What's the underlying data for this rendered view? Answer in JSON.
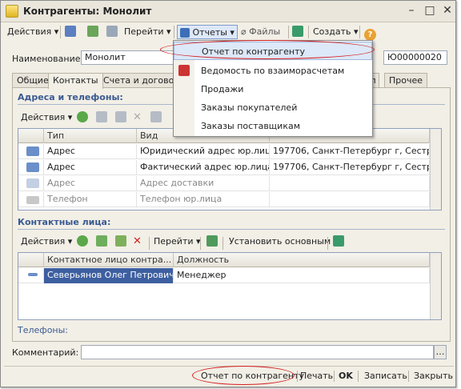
{
  "window": {
    "title": "Контрагенты: Монолит"
  },
  "toolbar": {
    "actions": "Действия",
    "goto": "Перейти",
    "reports": "Отчеты",
    "files": "Файлы",
    "create": "Создать"
  },
  "form": {
    "name_label": "Наименование:",
    "name_value": "Монолит",
    "code_value": "Ю00000020"
  },
  "tabs": [
    "Общие",
    "Контакты",
    "Счета и договоры",
    "Прочее"
  ],
  "tab_partial": "уп",
  "reports_menu": [
    "Отчет по контрагенту",
    "Ведомость по взаиморасчетам",
    "Продажи",
    "Заказы покупателей",
    "Заказы поставщикам"
  ],
  "addresses": {
    "section_title": "Адреса и телефоны:",
    "actions": "Действия",
    "columns": [
      "Тип",
      "Вид"
    ],
    "rows": [
      {
        "type": "Адрес",
        "kind": "Юридический адрес юр.лица",
        "value": "197706, Санкт-Петербург г, Сестро..."
      },
      {
        "type": "Адрес",
        "kind": "Фактический адрес юр.лица",
        "value": "197706, Санкт-Петербург г, Сестро..."
      },
      {
        "type": "Адрес",
        "kind": "Адрес доставки",
        "value": ""
      },
      {
        "type": "Телефон",
        "kind": "Телефон юр.лица",
        "value": ""
      }
    ]
  },
  "contacts": {
    "section_title": "Контактные лица:",
    "actions": "Действия",
    "goto": "Перейти",
    "set_main": "Установить основным",
    "columns": [
      "Контактное лицо контра...",
      "Должность"
    ],
    "rows": [
      {
        "name": "Северьянов Олег Петрович",
        "position": "Менеджер"
      }
    ]
  },
  "phones_label": "Телефоны:",
  "comment_label": "Комментарий:",
  "bottom": {
    "report": "Отчет по контрагенту",
    "print": "Печать",
    "ok": "OK",
    "save": "Записать",
    "close": "Закрыть"
  },
  "colors": {
    "highlight": "#dde8f8",
    "selection": "#3d5fa0",
    "annotation": "#d21d1d"
  }
}
